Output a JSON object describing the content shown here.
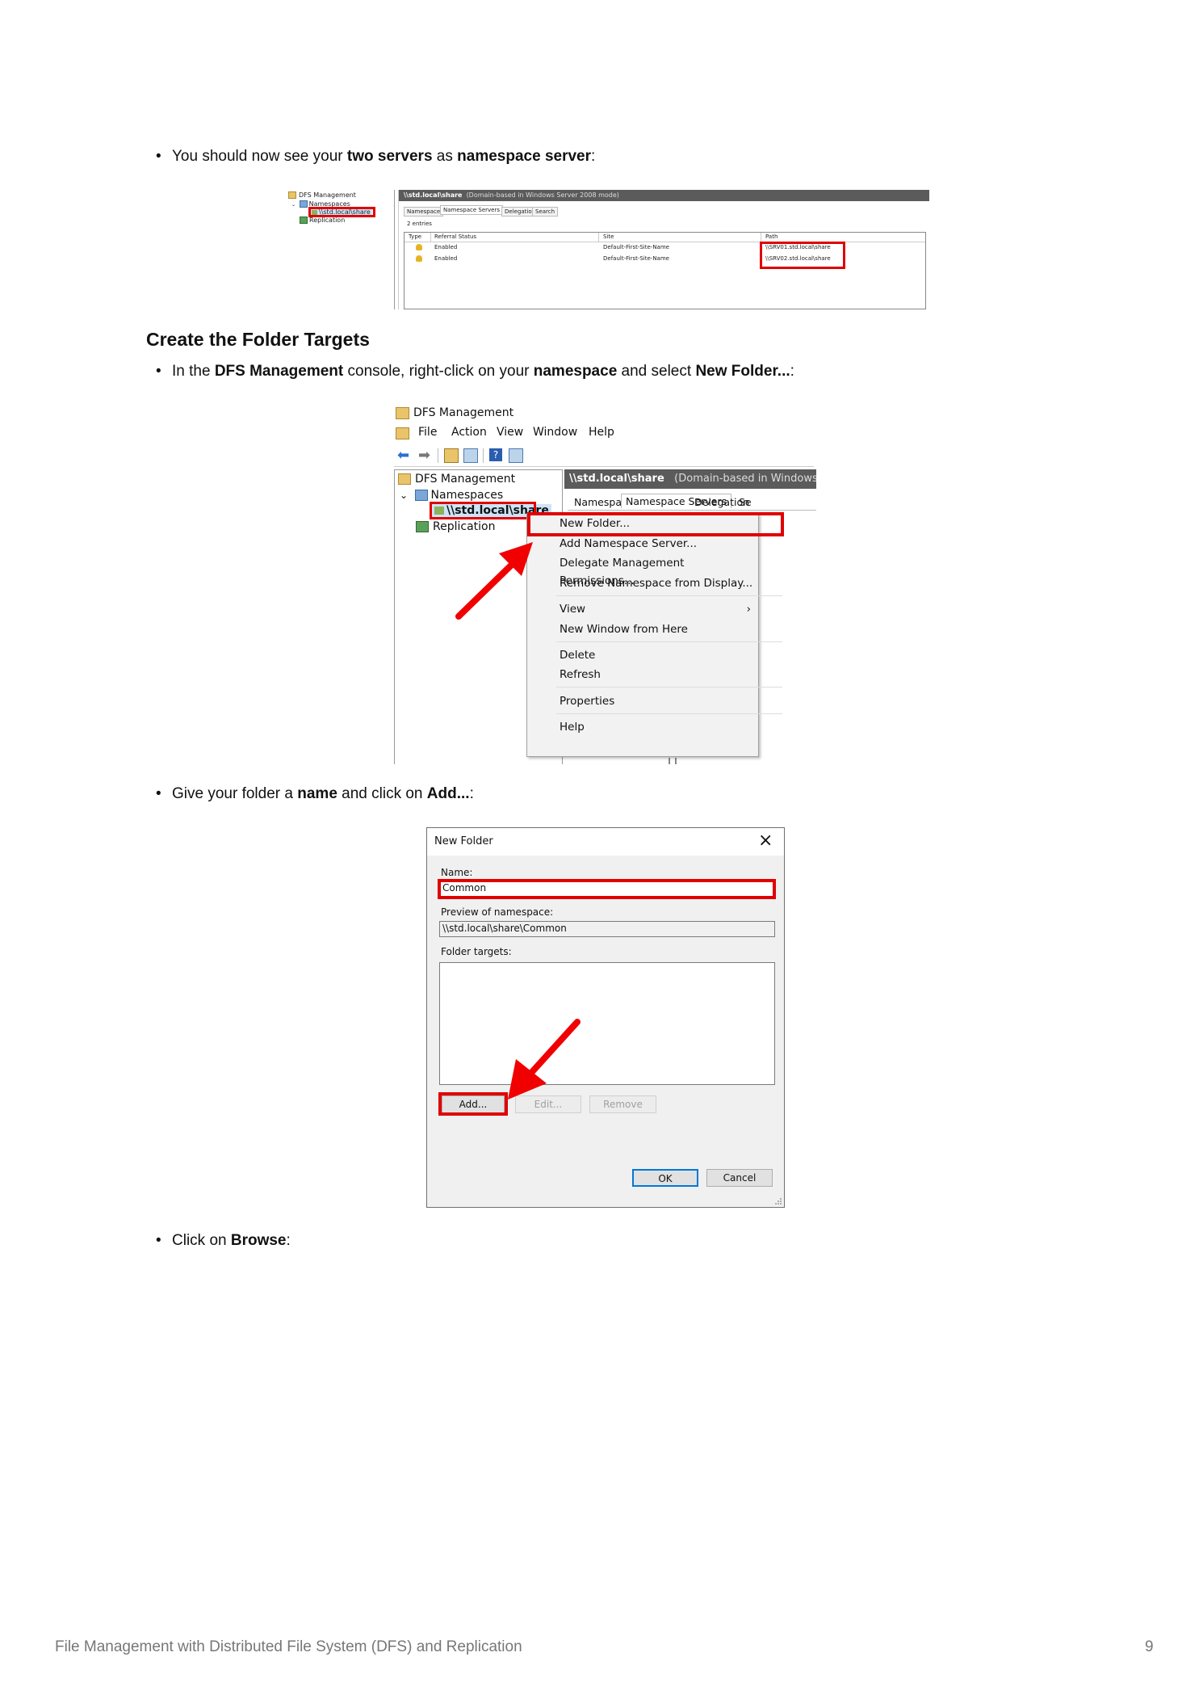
{
  "intro": {
    "prefix": "You should now see your ",
    "bold1": "two servers",
    "mid": " as ",
    "bold2": "namespace server",
    "suffix": ":"
  },
  "shot1": {
    "tree": {
      "root": "DFS Management",
      "namespaces": "Namespaces",
      "share": "\\\\std.local\\share",
      "replication": "Replication"
    },
    "header": {
      "path": "\\\\std.local\\share",
      "mode": "(Domain-based in Windows Server 2008 mode)"
    },
    "tabs": [
      "Namespace",
      "Namespace Servers",
      "Delegation",
      "Search"
    ],
    "entries": "2 entries",
    "columns": [
      "Type",
      "Referral Status",
      "Site",
      "Path"
    ],
    "rows": [
      {
        "status": "Enabled",
        "site": "Default-First-Site-Name",
        "path": "\\\\SRV01.std.local\\share"
      },
      {
        "status": "Enabled",
        "site": "Default-First-Site-Name",
        "path": "\\\\SRV02.std.local\\share"
      }
    ]
  },
  "heading": "Create the Folder Targets",
  "step1": {
    "prefix": "In the ",
    "bold1": "DFS Management",
    "mid1": " console, right-click on your ",
    "bold2": "namespace",
    "mid2": " and select ",
    "bold3": "New Folder...",
    "suffix": ":"
  },
  "shot2": {
    "title": "DFS Management",
    "menubar": [
      "File",
      "Action",
      "View",
      "Window",
      "Help"
    ],
    "tree": {
      "root": "DFS Management",
      "namespaces": "Namespaces",
      "share": "\\\\std.local\\share",
      "replication": "Replication"
    },
    "header": {
      "path": "\\\\std.local\\share",
      "mode": "(Domain-based in Windows Se"
    },
    "tabs": [
      "Namespace",
      "Namespace Servers",
      "Delegation",
      "Se"
    ],
    "menu": [
      "New Folder...",
      "Add Namespace Server...",
      "Delegate Management Permissions...",
      "Remove Namespace from Display...",
      "View",
      "New Window from Here",
      "Delete",
      "Refresh",
      "Properties",
      "Help"
    ],
    "submenu_arrow": "›"
  },
  "step2": {
    "prefix": "Give your folder a ",
    "bold1": "name",
    "mid": " and click on ",
    "bold2": "Add...",
    "suffix": ":"
  },
  "shot3": {
    "title": "New Folder",
    "close": "×",
    "name_label": "Name:",
    "name_value": "Common",
    "preview_label": "Preview of namespace:",
    "preview_value": "\\\\std.local\\share\\Common",
    "targets_label": "Folder targets:",
    "add": "Add...",
    "edit": "Edit...",
    "remove": "Remove",
    "ok": "OK",
    "cancel": "Cancel"
  },
  "step3": {
    "prefix": "Click on ",
    "bold1": "Browse",
    "suffix": ":"
  },
  "footer": {
    "title": "File Management with Distributed File System (DFS) and Replication",
    "page": "9"
  },
  "colors": {
    "highlight": "#e00000",
    "arrow": "#f00000",
    "footer": "#777777"
  }
}
